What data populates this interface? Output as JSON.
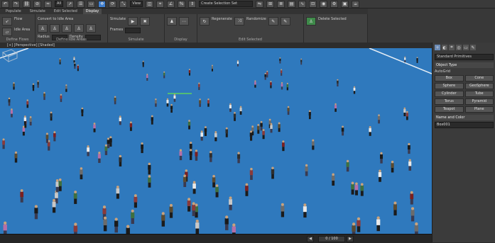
{
  "toolbar": {
    "selection_filter": "All",
    "view_dropdown": "View",
    "snap_dropdown": "Create Selection Set",
    "buttons": [
      "undo-icon",
      "redo-icon",
      "link-icon",
      "unlink-icon",
      "bind-icon",
      "select-icon",
      "select-name-icon",
      "rect-select-icon",
      "move-icon",
      "rotate-icon",
      "scale-icon",
      "snap-icon",
      "angle-snap-icon",
      "percent-snap-icon",
      "mirror-icon",
      "align-icon",
      "layer-icon",
      "scene-explorer-icon",
      "curve-editor-icon",
      "schematic-icon",
      "material-icon",
      "render-setup-icon",
      "render-frame-icon",
      "render-icon"
    ]
  },
  "tabs": [
    "Populate",
    "Simulate",
    "Edit Selected",
    "Display"
  ],
  "ribbon": {
    "groups": [
      {
        "label": "Define Flows",
        "texts": [
          "Flow",
          "Idle Area"
        ]
      },
      {
        "label": "Define Idle Areas",
        "texts": [
          "Convert to Idle Area",
          "Radius",
          "Density"
        ]
      },
      {
        "label": "Simulate",
        "texts": [
          "Simulate",
          "Frames"
        ]
      },
      {
        "label": "Display",
        "texts": []
      },
      {
        "label": "Edit Selected",
        "texts": [
          "Regenerate",
          "Randomize"
        ]
      },
      {
        "label": "",
        "texts": [
          "Delete Selected"
        ]
      }
    ]
  },
  "viewport": {
    "label": "[+] [Perspective] [Shaded]",
    "background": "#2f79bd"
  },
  "timebar": {
    "counter": "0 / 100"
  },
  "command_panel": {
    "dropdown": "Standard Primitives",
    "rollout_object_type": "Object Type",
    "autogrid": "AutoGrid",
    "buttons": [
      "Box",
      "Cone",
      "Sphere",
      "GeoSphere",
      "Cylinder",
      "Tube",
      "Torus",
      "Pyramid",
      "Teapot",
      "Plane"
    ],
    "rollout_name": "Name and Color",
    "object_name": "Box001"
  }
}
